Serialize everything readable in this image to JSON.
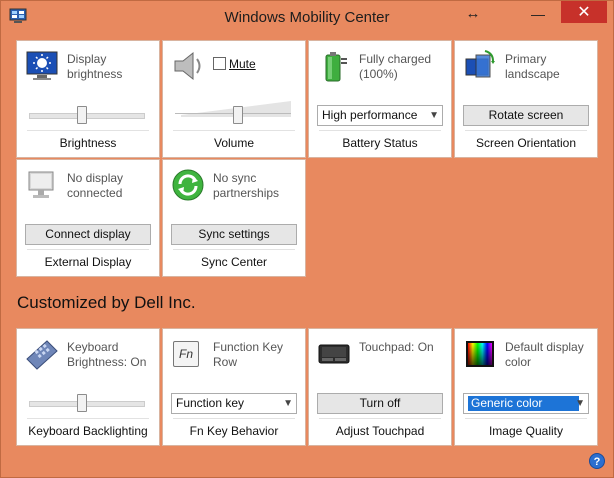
{
  "window": {
    "title": "Windows Mobility Center",
    "resize_glyph": "↔",
    "minimize_glyph": "—",
    "close_glyph": "✕"
  },
  "tiles": {
    "brightness": {
      "status": "Display brightness",
      "caption": "Brightness",
      "level": 0.45
    },
    "volume": {
      "mute_label": "Mute",
      "mute_checked": false,
      "caption": "Volume",
      "level": 0.55
    },
    "battery": {
      "status": "Fully charged (100%)",
      "plan_selected": "High performance",
      "caption": "Battery Status"
    },
    "orientation": {
      "status": "Primary landscape",
      "button": "Rotate screen",
      "caption": "Screen Orientation"
    },
    "external_display": {
      "status": "No display connected",
      "button": "Connect display",
      "caption": "External Display"
    },
    "sync": {
      "status": "No sync partnerships",
      "button": "Sync settings",
      "caption": "Sync Center"
    }
  },
  "custom_heading": "Customized by Dell Inc.",
  "custom_tiles": {
    "keyboard": {
      "status": "Keyboard Brightness: On",
      "caption": "Keyboard Backlighting",
      "level": 0.45
    },
    "fnkey": {
      "icon_text": "Fn",
      "status": "Function Key Row",
      "selected": "Function key",
      "caption": "Fn Key Behavior"
    },
    "touchpad": {
      "status": "Touchpad: On",
      "button": "Turn off",
      "caption": "Adjust Touchpad"
    },
    "image_quality": {
      "status": "Default display color",
      "selected": "Generic color",
      "caption": "Image Quality"
    }
  },
  "colors": {
    "background": "#e8895f",
    "close_button": "#c7312a",
    "selection": "#1d74d7"
  }
}
